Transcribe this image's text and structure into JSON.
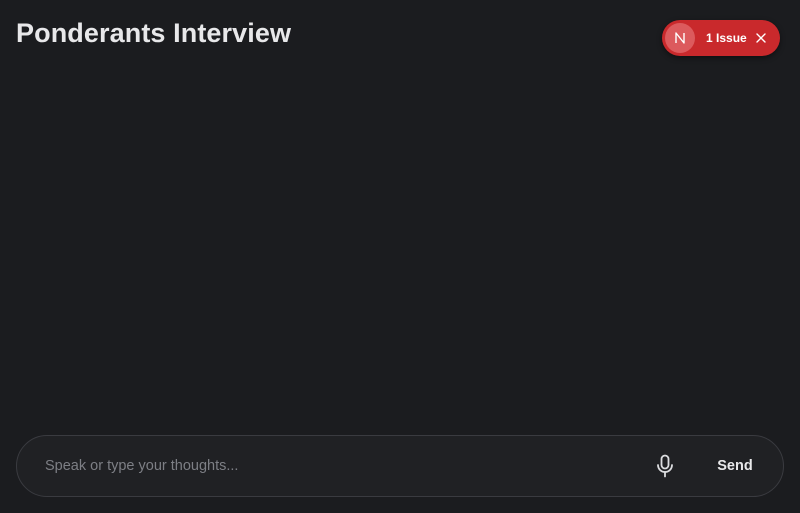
{
  "header": {
    "title": "Ponderants Interview"
  },
  "dev_indicator": {
    "badge_letter": "N",
    "issue_label": "1 Issue",
    "color": "#c9292c",
    "icon": "close-icon"
  },
  "composer": {
    "placeholder": "Speak or type your thoughts...",
    "value": "",
    "mic_icon": "microphone-icon",
    "send_label": "Send"
  },
  "colors": {
    "background": "#1b1c1f",
    "composer_border": "#3a3b40"
  }
}
